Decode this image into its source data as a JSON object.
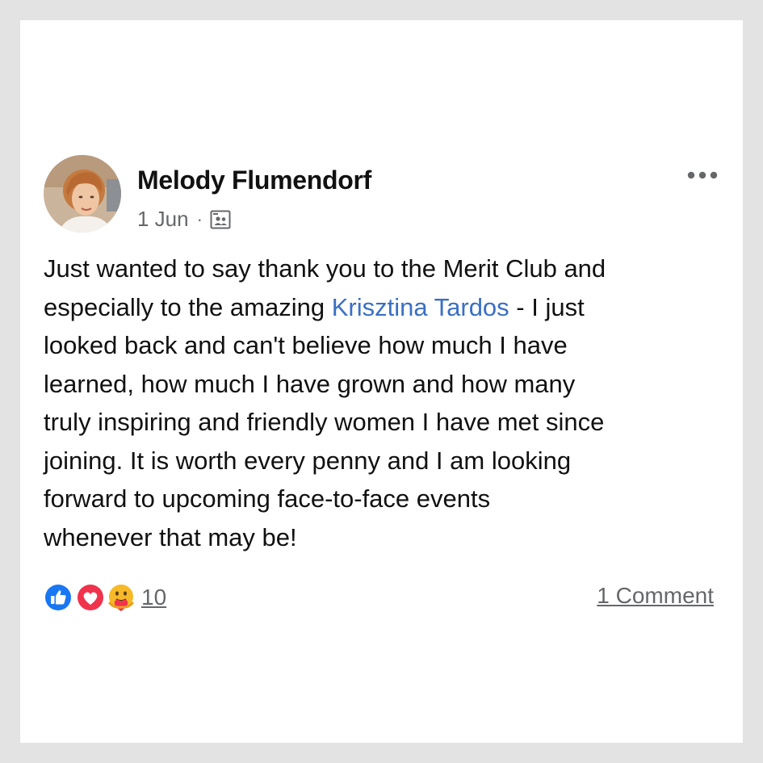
{
  "post": {
    "author": "Melody Flumendorf",
    "date": "1 Jun",
    "separator": "·",
    "audience_icon": "group-audience-icon",
    "more_icon": "more-options-icon",
    "text": {
      "line1": "Just wanted to say thank you to the Merit Club and",
      "line2_before": "especially to the amazing ",
      "mention": "Krisztina Tardos",
      "line2_after": " - I just",
      "line3": "looked back and can't believe how much I have",
      "line4": "learned, how much I have grown and how many",
      "line5": "truly inspiring and friendly women I have met since",
      "line6": "joining. It is worth every penny and I am looking",
      "line7": "forward to upcoming face-to-face events",
      "line8": "whenever that may be!"
    },
    "reactions": {
      "icons": [
        "like-reaction-icon",
        "love-reaction-icon",
        "care-reaction-icon"
      ],
      "count": "10"
    },
    "comments_label": "1 Comment"
  },
  "colors": {
    "background": "#e3e3e3",
    "card": "#ffffff",
    "text": "#111111",
    "secondary_text": "#65676b",
    "mention": "#3a6fc4",
    "like_blue": "#1877f2",
    "love_red": "#f0334c",
    "care_yellow": "#f7b928"
  }
}
